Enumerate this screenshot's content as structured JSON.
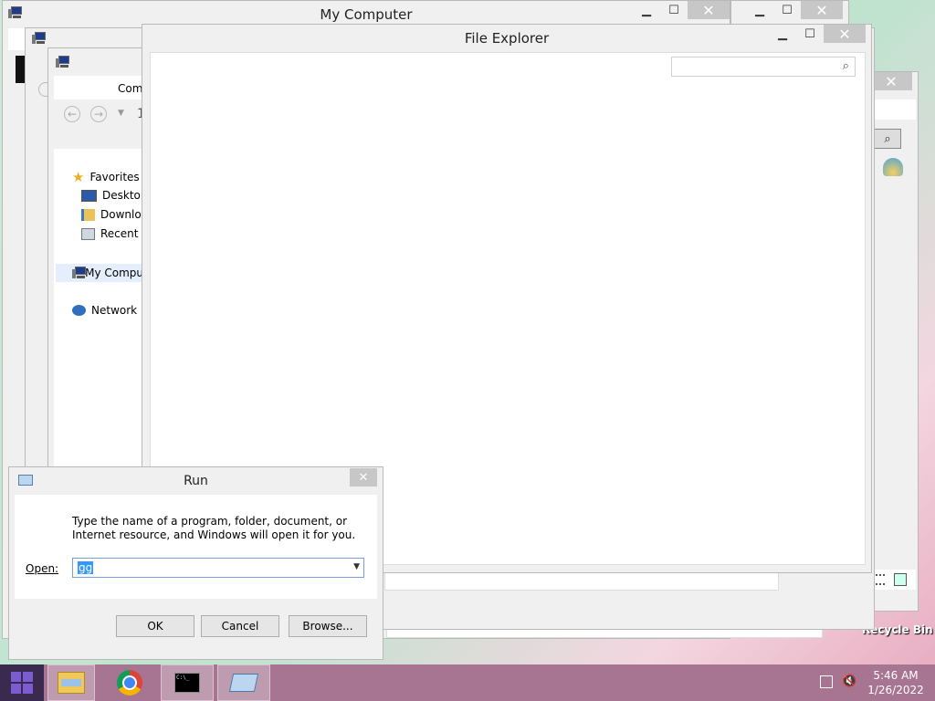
{
  "windows": {
    "my_computer": {
      "title": "My Computer"
    },
    "file_explorer": {
      "title": "File Explorer"
    },
    "back_window": {
      "tab_label": "Comp",
      "path_fragment": "1"
    }
  },
  "nav_pane": {
    "favorites_label": "Favorites",
    "items": [
      {
        "label": "Desktop"
      },
      {
        "label": "Downloa"
      },
      {
        "label": "Recent p"
      }
    ],
    "computer_label": "My Compu",
    "network_label": "Network"
  },
  "run_dialog": {
    "title": "Run",
    "description": "Type the name of a program, folder, document, or Internet resource, and Windows will open it for you.",
    "open_label": "Open:",
    "open_value": "gg",
    "ok_label": "OK",
    "cancel_label": "Cancel",
    "browse_label": "Browse..."
  },
  "desktop": {
    "recycle_bin_label": "Recycle Bin"
  },
  "taskbar": {
    "time": "5:46 AM",
    "date": "1/26/2022",
    "buttons": [
      {
        "icon": "file-explorer-icon"
      },
      {
        "icon": "chrome-icon"
      },
      {
        "icon": "command-prompt-icon"
      },
      {
        "icon": "run-icon"
      }
    ]
  },
  "colors": {
    "taskbar": "#a77591",
    "selection": "#3399ff",
    "start": "#5a2d91"
  }
}
